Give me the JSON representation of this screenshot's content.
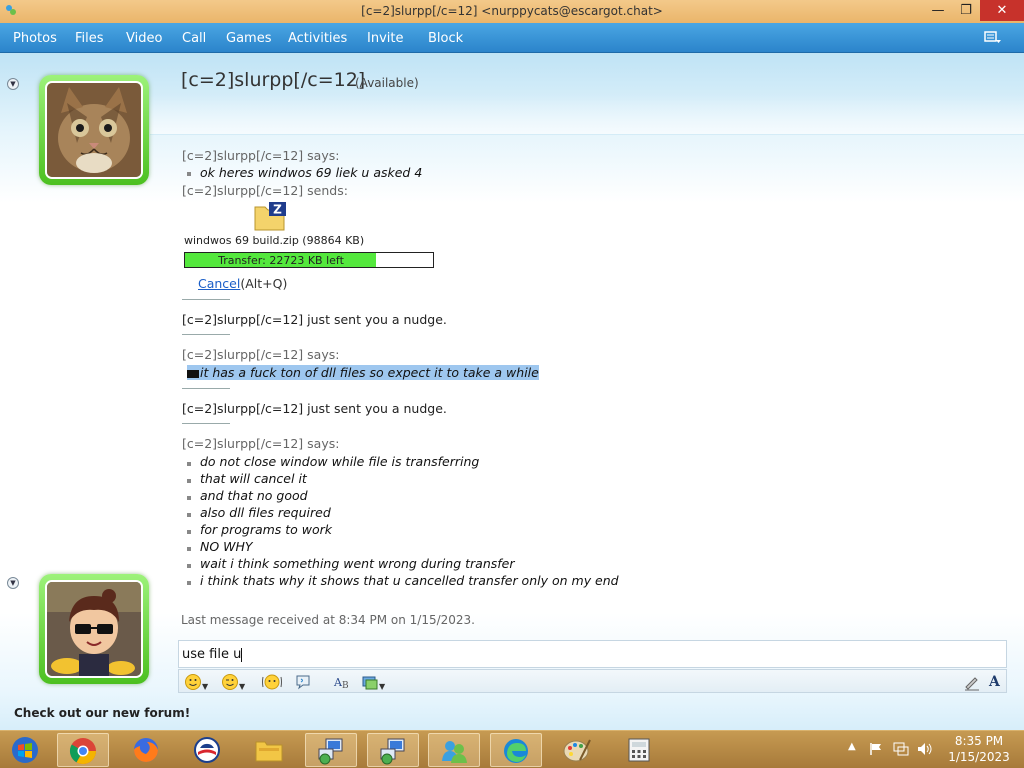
{
  "window": {
    "title": "[c=2]slurpp[/c=12] <nurppycats@escargot.chat>",
    "min_icon": "minimize-icon",
    "max_icon": "maximize-icon",
    "close_icon": "close-icon"
  },
  "menu": {
    "items": [
      "Photos",
      "Files",
      "Video",
      "Call",
      "Games",
      "Activities",
      "Invite",
      "Block"
    ],
    "options_icon": "options-menu-icon"
  },
  "contact": {
    "name": "[c=2]slurpp[/c=12]",
    "status": "(Available)"
  },
  "conversation": {
    "block1": {
      "says": "[c=2]slurpp[/c=12] says:",
      "messages": [
        "ok heres windwos 69 liek u asked 4"
      ]
    },
    "file": {
      "sends": "[c=2]slurpp[/c=12] sends:",
      "name": "windwos 69 build.zip (98864 KB)",
      "transfer_text": "Transfer: 22723 KB left",
      "progress_percent": 77,
      "cancel_label": "Cancel",
      "cancel_shortcut": "(Alt+Q)"
    },
    "nudge1": "[c=2]slurpp[/c=12] just sent you a nudge.",
    "block2": {
      "says": "[c=2]slurpp[/c=12] says:",
      "messages": [
        "it has a fuck ton of dll files so expect it to take a while"
      ]
    },
    "nudge2": "[c=2]slurpp[/c=12] just sent you a nudge.",
    "block3": {
      "says": "[c=2]slurpp[/c=12] says:",
      "messages": [
        "do not close window while file is transferring",
        "that will cancel it",
        "and that no good",
        "also dll files required",
        "for programs to work",
        "NO WHY",
        "wait i think something went wrong during transfer",
        "i think thats why it shows that u cancelled transfer only on my end"
      ]
    },
    "last_received": "Last message received at 8:34 PM on 1/15/2023."
  },
  "input": {
    "value": "use file u"
  },
  "toolbar": {
    "icons": [
      "emoticon-icon",
      "wink-icon",
      "nudge-icon",
      "voice-clip-icon",
      "font-icon",
      "background-icon",
      "handwriting-icon",
      "text-mode-icon"
    ]
  },
  "footer": {
    "forum_link": "Check out our new forum!"
  },
  "taskbar": {
    "apps": [
      "start-orb-icon",
      "chrome-icon",
      "firefox-icon",
      "obama-icon",
      "file-explorer-icon",
      "network-app-icon",
      "network-app-2-icon",
      "messenger-icon",
      "edge-icon",
      "paint-icon",
      "calculator-icon"
    ],
    "clock_time": "8:35 PM",
    "clock_date": "1/15/2023"
  },
  "colors": {
    "menu_bar": "#2b84cb",
    "title_bar": "#eab56a",
    "taskbar": "#a77a3a",
    "progress": "#54e83d",
    "highlight": "#9ec7ef",
    "link": "#1a5ec8"
  }
}
